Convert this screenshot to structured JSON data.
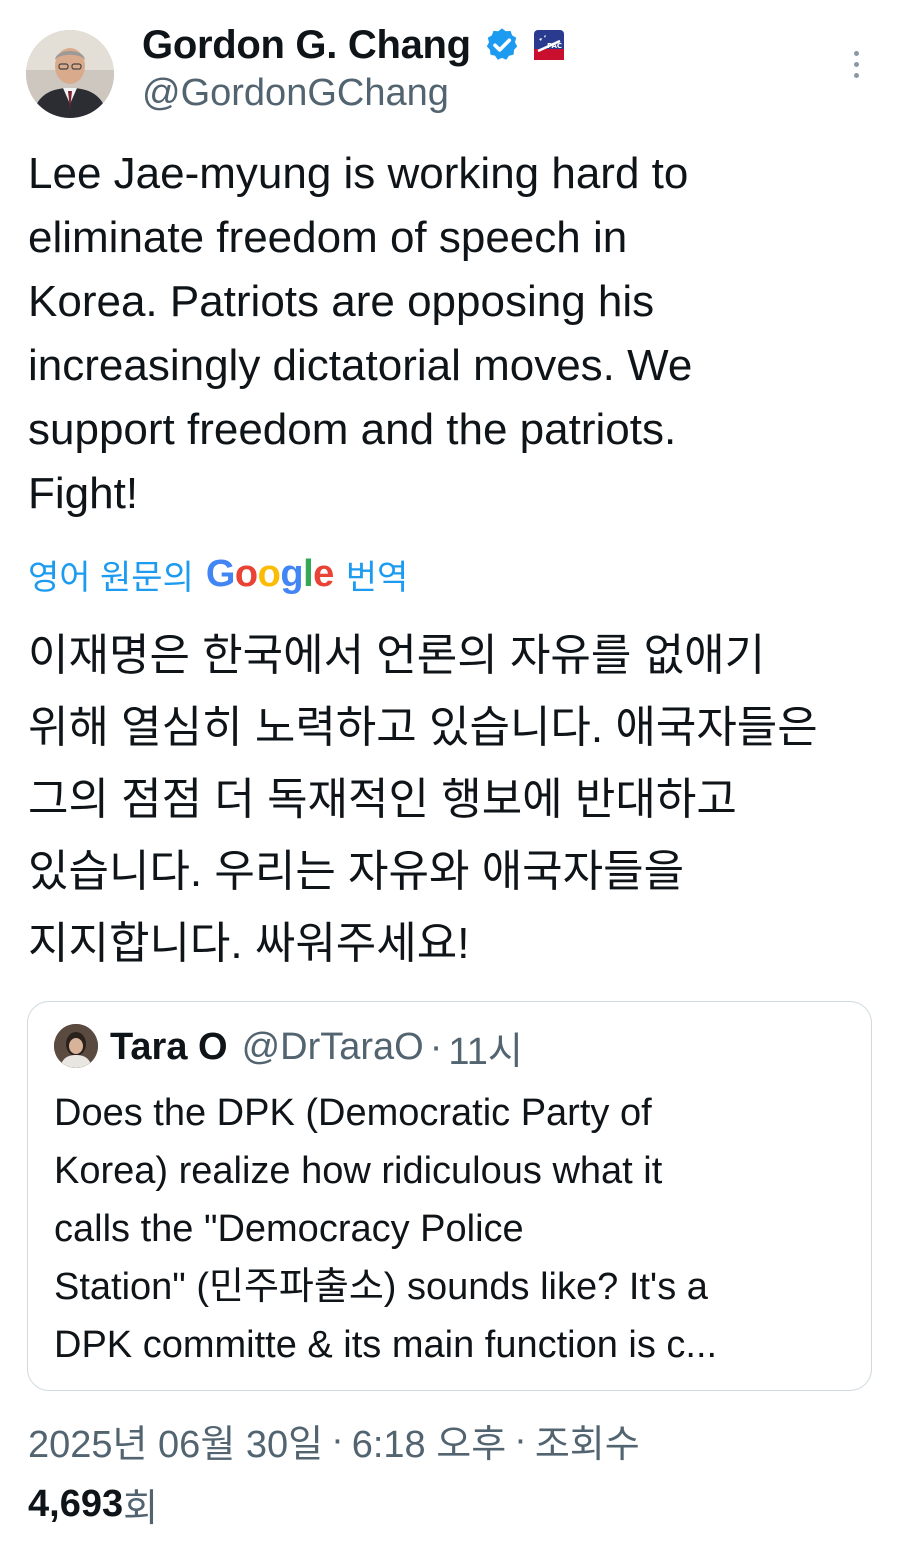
{
  "author": {
    "name": "Gordon G. Chang",
    "handle": "@GordonGChang",
    "verified_color": "#1d9bf0",
    "badge_icon": "cpac-badge-icon"
  },
  "tweet": {
    "text": "Lee Jae-myung is working hard to\neliminate freedom of speech in\nKorea. Patriots are opposing his\nincreasingly dictatorial moves. We\nsupport freedom and the patriots.\nFight!",
    "translate_prefix": "영어 원문의",
    "translate_brand": "Google",
    "translate_suffix": "번역",
    "translated_text": "이재명은 한국에서 언론의 자유를 없애기\n위해 열심히 노력하고 있습니다. 애국자들은\n그의 점점 더 독재적인 행보에 반대하고\n있습니다. 우리는 자유와 애국자들을\n지지합니다. 싸워주세요!"
  },
  "quote": {
    "name": "Tara O",
    "handle": "@DrTaraO",
    "separator": "·",
    "time": "11시",
    "text": "Does the DPK (Democratic Party of\nKorea) realize how ridiculous what it\ncalls the \"Democracy Police\nStation\" (민주파출소) sounds like? It's a\nDPK committe & its main function is c..."
  },
  "meta": {
    "date": "2025년 06월 30일",
    "separator": "·",
    "time": "6:18 오후",
    "views_label": "조회수",
    "views_count": "4,693",
    "views_unit": "회"
  },
  "colors": {
    "accent": "#1d9bf0",
    "text": "#0f1419",
    "secondary": "#536471",
    "border": "#cfd9de"
  }
}
